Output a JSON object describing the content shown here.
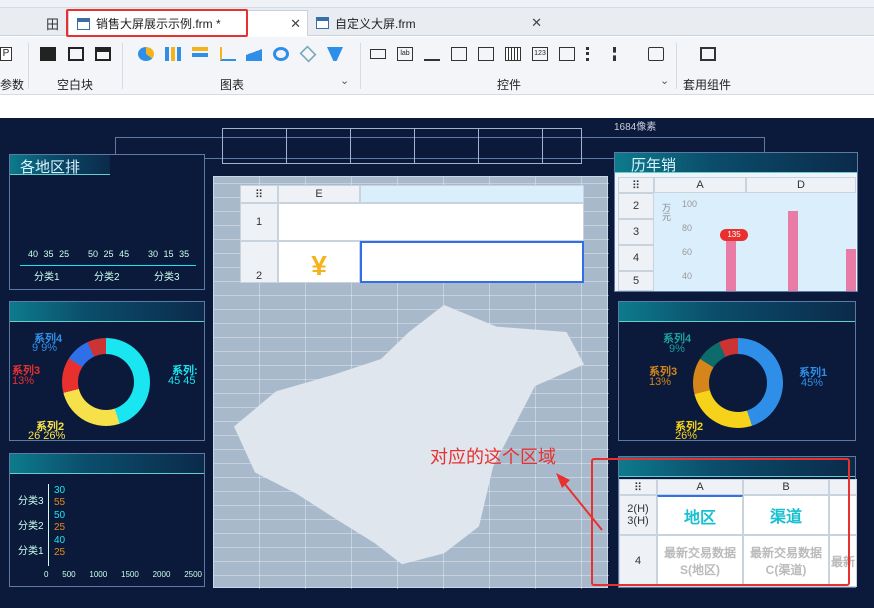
{
  "tabs": [
    {
      "label": "销售大屏展示示例.frm *",
      "active": true
    },
    {
      "label": "自定义大屏.frm",
      "active": false
    }
  ],
  "ribbon": {
    "groups": [
      {
        "label": "参数"
      },
      {
        "label": "空白块"
      },
      {
        "label": "图表"
      },
      {
        "label": "控件"
      },
      {
        "label": "套用组件"
      }
    ]
  },
  "canvas": {
    "ruler_label": "1684像素",
    "left_top_title": "各地区排",
    "left_top_bars": {
      "categories": [
        "分类1",
        "分类2",
        "分类3"
      ],
      "values": [
        [
          "40",
          "35",
          "25"
        ],
        [
          "50",
          "25",
          "45"
        ],
        [
          "30",
          "15",
          "35"
        ]
      ]
    },
    "left_donut": {
      "s4": "系列4",
      "s4v": "9 9%",
      "s3": "系列3",
      "s3v": "13%",
      "s2": "系列2",
      "s2v": "26 26%",
      "s1": "系列:",
      "s1v": "45 45"
    },
    "left_bottom": {
      "rows": [
        "分类3",
        "分类2",
        "分类1"
      ],
      "pairs": [
        [
          "30",
          "55"
        ],
        [
          "50",
          "25"
        ],
        [
          "40",
          "25"
        ]
      ],
      "xticks": [
        "0",
        "500",
        "1000",
        "1500",
        "2000",
        "2500"
      ]
    },
    "center_grid": {
      "col_header": "E",
      "row1": "1",
      "row2": "2"
    },
    "right_top": {
      "title": "历年销",
      "colA": "A",
      "colD": "D",
      "rows": [
        "2",
        "3",
        "4",
        "5"
      ],
      "ylabel": "万元",
      "yticks": [
        "100",
        "80",
        "60",
        "40"
      ],
      "badge": "135"
    },
    "right_donut": {
      "s4": "系列4",
      "s4v": "9%",
      "s3": "系列3",
      "s3v": "13%",
      "s2": "系列2",
      "s2v": "26%",
      "s1": "系列1",
      "s1v": "45%"
    },
    "annotation": "对应的这个区域",
    "right_bottom": {
      "colA": "A",
      "colB": "B",
      "r2": "2(H)",
      "r3": "3(H)",
      "r4": "4",
      "h1": "地区",
      "h2": "渠道",
      "c1": "最新交易数据 S(地区)",
      "c2": "最新交易数据 C(渠道)",
      "c3": "最新"
    }
  },
  "colors": {
    "accent_red": "#e8312f",
    "cyan": "#19e6f0",
    "canvas_bg": "#0b1a3b"
  }
}
